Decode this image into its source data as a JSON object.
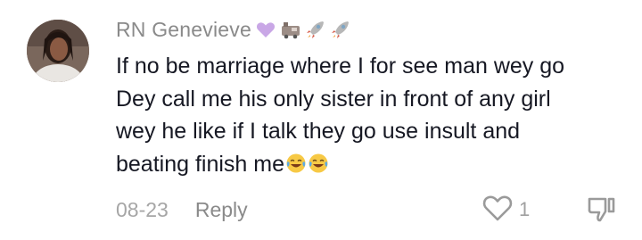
{
  "comment": {
    "username": "RN Genevieve",
    "username_emojis": [
      "purple-heart",
      "train",
      "rocket",
      "rocket"
    ],
    "text_lines": [
      "If no be marriage where I for see man wey go",
      "Dey call me his only sister in front of any girl",
      "wey he like if I talk they go use insult and",
      "beating finish me"
    ],
    "trailing_emojis": [
      "face-with-tears-of-joy",
      "face-with-tears-of-joy"
    ],
    "timestamp": "08-23",
    "reply_label": "Reply",
    "like_count": "1"
  },
  "colors": {
    "username": "#8a8a8a",
    "body_text": "#161823",
    "meta_text": "#a6a6a6",
    "icon_stroke": "#9a9a9a"
  }
}
